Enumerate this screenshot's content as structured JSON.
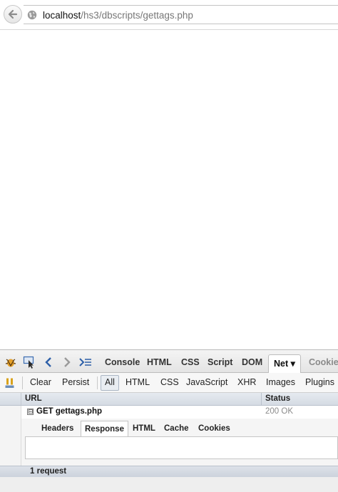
{
  "browser": {
    "url_host": "localhost",
    "url_path": "/hs3/dbscripts/gettags.php",
    "back_icon": "back-arrow-icon",
    "site_icon": "globe-icon"
  },
  "firebug": {
    "tools": {
      "firebug_icon": "firebug-bug-icon",
      "inspect_icon": "inspect-pointer-icon",
      "prev_icon": "chevron-left-icon",
      "next_icon": "chevron-right-icon",
      "command_icon": "command-line-icon"
    },
    "tabs": [
      {
        "label": "Console"
      },
      {
        "label": "HTML"
      },
      {
        "label": "CSS"
      },
      {
        "label": "Script"
      },
      {
        "label": "DOM"
      },
      {
        "label": "Net ▾"
      },
      {
        "label": "Cookies"
      }
    ],
    "active_tab": "Net",
    "toolbar": {
      "pause_icon": "pause-xhr-icon",
      "buttons": [
        {
          "label": "Clear"
        },
        {
          "label": "Persist"
        },
        {
          "label": "All"
        },
        {
          "label": "HTML"
        },
        {
          "label": "CSS"
        },
        {
          "label": "JavaScript"
        },
        {
          "label": "XHR"
        },
        {
          "label": "Images"
        },
        {
          "label": "Plugins"
        }
      ],
      "active_filter": "All"
    },
    "columns": {
      "url": "URL",
      "status": "Status"
    },
    "requests": [
      {
        "expander": "⊟",
        "method_url": "GET gettags.php",
        "status": "200 OK"
      }
    ],
    "detail_tabs": [
      {
        "label": "Headers"
      },
      {
        "label": "Response"
      },
      {
        "label": "HTML"
      },
      {
        "label": "Cache"
      },
      {
        "label": "Cookies"
      }
    ],
    "active_detail_tab": "Response",
    "footer": "1 request"
  }
}
